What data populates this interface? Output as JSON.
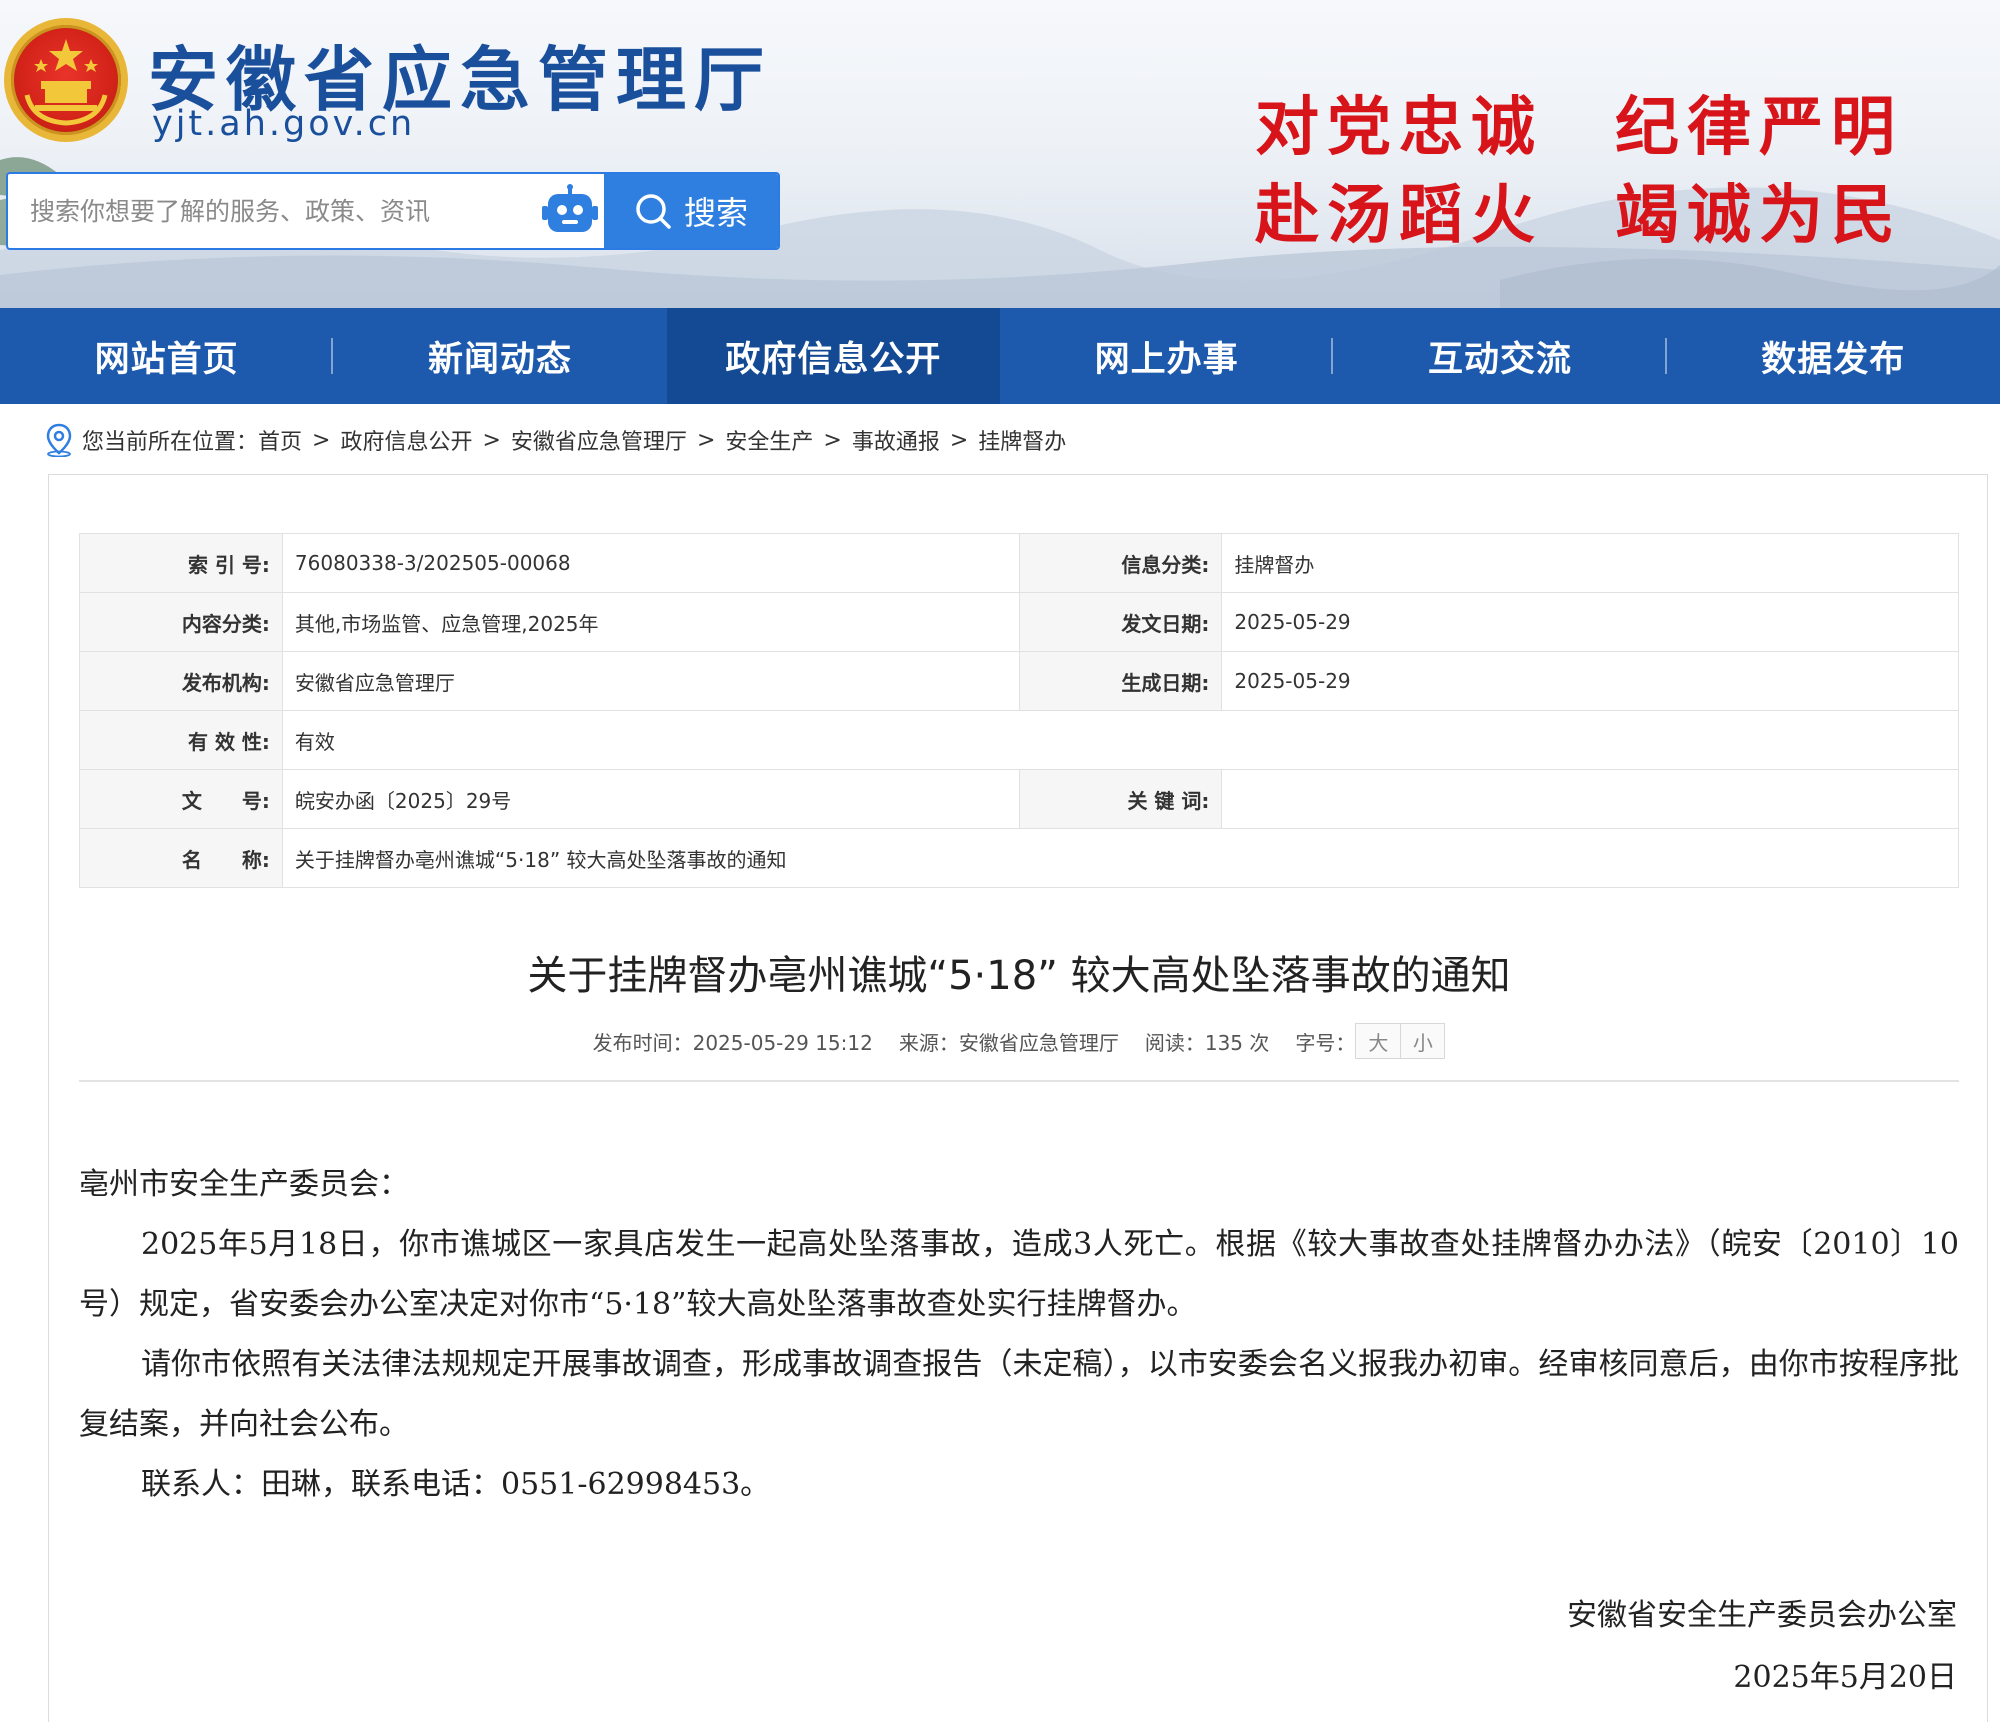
{
  "header": {
    "site_title": "安徽省应急管理厅",
    "site_domain": "yjt.ah.gov.cn",
    "slogan_line1": "对党忠诚　纪律严明",
    "slogan_line2": "赴汤蹈火　竭诚为民",
    "search_placeholder": "搜索你想要了解的服务、政策、资讯",
    "search_button_label": "搜索"
  },
  "nav": {
    "items": [
      {
        "label": "网站首页"
      },
      {
        "label": "新闻动态"
      },
      {
        "label": "政府信息公开"
      },
      {
        "label": "网上办事"
      },
      {
        "label": "互动交流"
      },
      {
        "label": "数据发布"
      }
    ]
  },
  "breadcrumb": {
    "prefix": "您当前所在位置：",
    "items": [
      "首页",
      "政府信息公开",
      "安徽省应急管理厅",
      "安全生产",
      "事故通报",
      "挂牌督办"
    ]
  },
  "meta": {
    "index_label": "索 引 号:",
    "index_value": "76080338-3/202505-00068",
    "info_category_label": "信息分类:",
    "info_category_value": "挂牌督办",
    "content_category_label": "内容分类:",
    "content_category_value": "其他,市场监管、应急管理,2025年",
    "issue_date_label": "发文日期:",
    "issue_date_value": "2025-05-29",
    "publisher_label": "发布机构:",
    "publisher_value": "安徽省应急管理厅",
    "generate_date_label": "生成日期:",
    "generate_date_value": "2025-05-29",
    "validity_label": "有 效 性:",
    "validity_value": "有效",
    "doc_number_label": "文　　号:",
    "doc_number_value": "皖安办函〔2025〕29号",
    "keywords_label": "关 键 词:",
    "keywords_value": "",
    "name_label": "名　　称:",
    "name_value": "关于挂牌督办亳州谯城“5·18” 较大高处坠落事故的通知"
  },
  "document": {
    "title": "关于挂牌督办亳州谯城“5·18” 较大高处坠落事故的通知",
    "publish_time": "发布时间：2025-05-29 15:12",
    "source": "来源：安徽省应急管理厅",
    "reads": "阅读：135 次",
    "font_size_label": "字号：",
    "font_large": "大",
    "font_small": "小",
    "salutation": "亳州市安全生产委员会：",
    "paragraph1": "2025年5月18日，你市谯城区一家具店发生一起高处坠落事故，造成3人死亡。根据《较大事故查处挂牌督办办法》（皖安〔2010〕10号）规定，省安委会办公室决定对你市“5·18”较大高处坠落事故查处实行挂牌督办。",
    "paragraph2": "请你市依照有关法律法规规定开展事故调查，形成事故调查报告（未定稿），以市安委会名义报我办初审。经审核同意后，由你市按程序批复结案，并向社会公布。",
    "paragraph3": "联系人：田琳，联系电话：0551-62998453。",
    "signature_org": "安徽省安全生产委员会办公室",
    "signature_date": "2025年5月20日"
  },
  "colors": {
    "brand_blue": "#1d5aae",
    "nav_active": "#134a93",
    "slogan_red": "#d7141a",
    "search_blue": "#2f7fe0"
  }
}
